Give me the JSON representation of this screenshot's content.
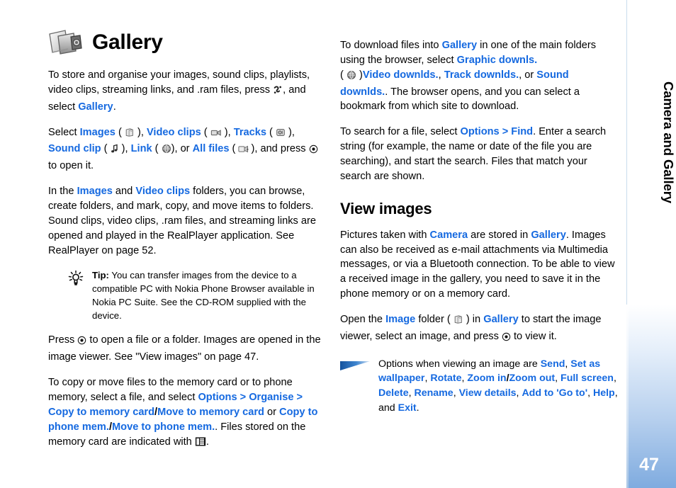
{
  "document": {
    "title": "Gallery",
    "title_icon": "gallery-camera-icon",
    "chapter_label": "Camera and Gallery",
    "page_number": "47",
    "accent_color": "#1569e0",
    "sidebar_gradient_bottom": "#7fabdf"
  },
  "left_column": {
    "paragraphs": [
      {
        "id": "p-intro",
        "runs": [
          {
            "t": "To store and organise your images, sound clips, playlists, video clips, streaming links, and .ram files, press "
          },
          {
            "t": "menu-key-icon",
            "k": "icon"
          },
          {
            "t": ", and select "
          },
          {
            "t": "Gallery",
            "k": "link"
          },
          {
            "t": "."
          }
        ]
      },
      {
        "id": "p-select",
        "runs": [
          {
            "t": "Select "
          },
          {
            "t": "Images",
            "k": "link"
          },
          {
            "t": " ( "
          },
          {
            "t": "images-folder-icon",
            "k": "icon"
          },
          {
            "t": " ), "
          },
          {
            "t": "Video clips",
            "k": "link"
          },
          {
            "t": " ( "
          },
          {
            "t": "video-clips-icon",
            "k": "icon"
          },
          {
            "t": " ), "
          },
          {
            "t": "Tracks",
            "k": "link"
          },
          {
            "t": " ( "
          },
          {
            "t": "tracks-icon",
            "k": "icon"
          },
          {
            "t": " ), "
          },
          {
            "t": "Sound clip",
            "k": "link"
          },
          {
            "t": " ( "
          },
          {
            "t": "sound-clip-icon",
            "k": "icon"
          },
          {
            "t": " ), "
          },
          {
            "t": "Link",
            "k": "link"
          },
          {
            "t": " ( "
          },
          {
            "t": "link-globe-icon",
            "k": "icon"
          },
          {
            "t": "), or "
          },
          {
            "t": "All files",
            "k": "link"
          },
          {
            "t": " ( "
          },
          {
            "t": "all-files-icon",
            "k": "icon"
          },
          {
            "t": "), and press "
          },
          {
            "t": "scroll-key-icon",
            "k": "icon"
          },
          {
            "t": " to open it."
          }
        ]
      },
      {
        "id": "p-folders",
        "runs": [
          {
            "t": "In the "
          },
          {
            "t": "Images",
            "k": "link"
          },
          {
            "t": " and "
          },
          {
            "t": "Video clips",
            "k": "link"
          },
          {
            "t": " folders, you can browse, create folders, and mark, copy, and move items to folders. Sound clips, video clips, .ram files, and streaming links are opened and played in the RealPlayer application. See RealPlayer on page 52."
          }
        ]
      }
    ],
    "tip": {
      "icon": "light-bulb-tip-icon",
      "label": "Tip:",
      "text": " You can transfer images from the device to a compatible PC with Nokia Phone Browser available in Nokia PC Suite. See the CD-ROM supplied with the device."
    },
    "paragraphs_after_tip": [
      {
        "id": "p-press-open",
        "runs": [
          {
            "t": "Press "
          },
          {
            "t": "scroll-key-icon",
            "k": "icon"
          },
          {
            "t": " to open a file or a folder. Images are opened in the image viewer. See \"View images\" on page 47."
          }
        ]
      },
      {
        "id": "p-copy-move",
        "runs": [
          {
            "t": "To copy or move files to the memory card or to phone memory, select a file, and select "
          },
          {
            "t": "Options > Organise > Copy to memory card",
            "k": "link"
          },
          {
            "t": "/",
            "k": "sep"
          },
          {
            "t": "Move to memory card",
            "k": "link"
          },
          {
            "t": " or "
          },
          {
            "t": "Copy to phone mem.",
            "k": "link"
          },
          {
            "t": "/",
            "k": "sep"
          },
          {
            "t": "Move to phone mem.",
            "k": "link"
          },
          {
            "t": ". Files stored on the memory card are indicated with "
          },
          {
            "t": "memory-card-icon",
            "k": "icon"
          },
          {
            "t": "."
          }
        ]
      }
    ]
  },
  "right_column": {
    "paragraphs": [
      {
        "id": "p-download",
        "runs": [
          {
            "t": "To download files into "
          },
          {
            "t": "Gallery",
            "k": "link"
          },
          {
            "t": " in one of the main folders using the browser, select "
          },
          {
            "t": "Graphic downls.",
            "k": "link"
          },
          {
            "t": " ( "
          },
          {
            "t": "link-globe-icon",
            "k": "icon"
          },
          {
            "t": " )"
          },
          {
            "t": "Video downlds.",
            "k": "link"
          },
          {
            "t": ", "
          },
          {
            "t": "Track downlds.",
            "k": "link"
          },
          {
            "t": ", or "
          },
          {
            "t": "Sound downlds.",
            "k": "link"
          },
          {
            "t": ". The browser opens, and you can select a bookmark from which site to download."
          }
        ]
      },
      {
        "id": "p-find",
        "runs": [
          {
            "t": "To search for a file, select "
          },
          {
            "t": "Options > Find",
            "k": "link"
          },
          {
            "t": ". Enter a search string (for example, the name or date of the file you are searching), and start the search. Files that match your search are shown."
          }
        ]
      }
    ],
    "section_heading": "View images",
    "paragraphs_after_heading": [
      {
        "id": "p-pictures",
        "runs": [
          {
            "t": "Pictures taken with "
          },
          {
            "t": "Camera",
            "k": "link"
          },
          {
            "t": " are stored in "
          },
          {
            "t": "Gallery",
            "k": "link"
          },
          {
            "t": ". Images can also be received as e-mail attachments via Multimedia messages, or via a Bluetooth connection. To be able to view a received image in the gallery, you need to save it in the phone memory or on a memory card."
          }
        ]
      },
      {
        "id": "p-open-image",
        "runs": [
          {
            "t": "Open the "
          },
          {
            "t": "Image",
            "k": "link"
          },
          {
            "t": " folder ( "
          },
          {
            "t": "images-folder-icon",
            "k": "icon"
          },
          {
            "t": " ) in "
          },
          {
            "t": "Gallery",
            "k": "link"
          },
          {
            "t": " to start the image viewer, select an image, and press "
          },
          {
            "t": "scroll-key-icon",
            "k": "icon"
          },
          {
            "t": " to view it."
          }
        ]
      }
    ],
    "note": {
      "icon": "blue-wedge-note-icon",
      "runs": [
        {
          "t": "Options when viewing an image are "
        },
        {
          "t": "Send",
          "k": "link"
        },
        {
          "t": ", "
        },
        {
          "t": "Set as wallpaper",
          "k": "link"
        },
        {
          "t": ", "
        },
        {
          "t": "Rotate",
          "k": "link"
        },
        {
          "t": ", "
        },
        {
          "t": "Zoom in",
          "k": "link"
        },
        {
          "t": "/",
          "k": "sep"
        },
        {
          "t": "Zoom out",
          "k": "link"
        },
        {
          "t": ", "
        },
        {
          "t": "Full screen",
          "k": "link"
        },
        {
          "t": ", "
        },
        {
          "t": "Delete",
          "k": "link"
        },
        {
          "t": ", "
        },
        {
          "t": "Rename",
          "k": "link"
        },
        {
          "t": ", "
        },
        {
          "t": "View details",
          "k": "link"
        },
        {
          "t": ", "
        },
        {
          "t": "Add to 'Go to'",
          "k": "link"
        },
        {
          "t": ", "
        },
        {
          "t": "Help",
          "k": "link"
        },
        {
          "t": ", and "
        },
        {
          "t": "Exit",
          "k": "link"
        },
        {
          "t": "."
        }
      ]
    }
  }
}
